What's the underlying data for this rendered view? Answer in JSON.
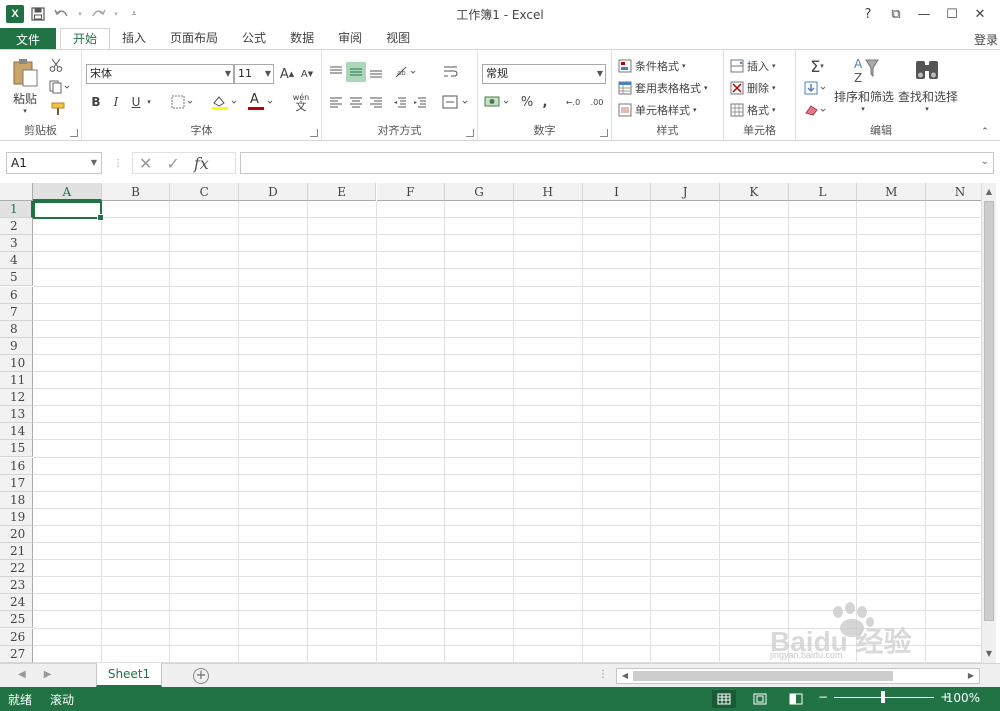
{
  "window": {
    "title": "工作簿1 - Excel"
  },
  "qat": {
    "logo": "X",
    "save_icon": "save-icon",
    "undo_icon": "undo-icon",
    "redo_icon": "redo-icon"
  },
  "window_controls": [
    "?",
    "⧉",
    "—",
    "☐",
    "✕"
  ],
  "tabs": {
    "file": "文件",
    "items": [
      "开始",
      "插入",
      "页面布局",
      "公式",
      "数据",
      "审阅",
      "视图"
    ],
    "active": "开始",
    "login": "登录"
  },
  "ribbon": {
    "clipboard": {
      "label": "剪贴板",
      "paste": "粘贴"
    },
    "font": {
      "label": "字体",
      "font_name": "宋体",
      "font_size": "11",
      "bold": "B",
      "italic": "I",
      "underline": "U",
      "grow": "A",
      "shrink": "A",
      "font_color_letter": "A",
      "phonetic": "wén"
    },
    "alignment": {
      "label": "对齐方式"
    },
    "number": {
      "label": "数字",
      "format": "常规",
      "percent": "%",
      "comma": ",",
      "inc_decimal": "←.0",
      "dec_decimal": ".00"
    },
    "styles": {
      "label": "样式",
      "conditional": "条件格式",
      "table": "套用表格格式",
      "cell_styles": "单元格样式"
    },
    "cells": {
      "label": "单元格",
      "insert": "插入",
      "delete": "删除",
      "format": "格式"
    },
    "editing": {
      "label": "编辑",
      "sort": "排序和筛选",
      "find": "查找和选择"
    }
  },
  "formula_bar": {
    "name_box": "A1",
    "cancel": "✕",
    "enter": "✓",
    "fx": "fx",
    "value": ""
  },
  "grid": {
    "columns": [
      "A",
      "B",
      "C",
      "D",
      "E",
      "F",
      "G",
      "H",
      "I",
      "J",
      "K",
      "L",
      "M",
      "N"
    ],
    "rows": [
      "1",
      "2",
      "3",
      "4",
      "5",
      "6",
      "7",
      "8",
      "9",
      "10",
      "11",
      "12",
      "13",
      "14",
      "15",
      "16",
      "17",
      "18",
      "19",
      "20",
      "21",
      "22",
      "23",
      "24",
      "25",
      "26",
      "27"
    ],
    "selected_cell": "A1"
  },
  "sheets": {
    "tabs": [
      "Sheet1"
    ],
    "add": "+"
  },
  "status": {
    "ready": "就绪",
    "scroll": "滚动",
    "zoom": "100%",
    "zoom_minus": "−",
    "zoom_plus": "+"
  },
  "watermark": {
    "brand": "Baidu 经验",
    "url": "jingyan.baidu.com"
  },
  "colors": {
    "accent": "#217346",
    "gridline": "#e1e1e1",
    "header_bg": "#f2f2f2"
  }
}
